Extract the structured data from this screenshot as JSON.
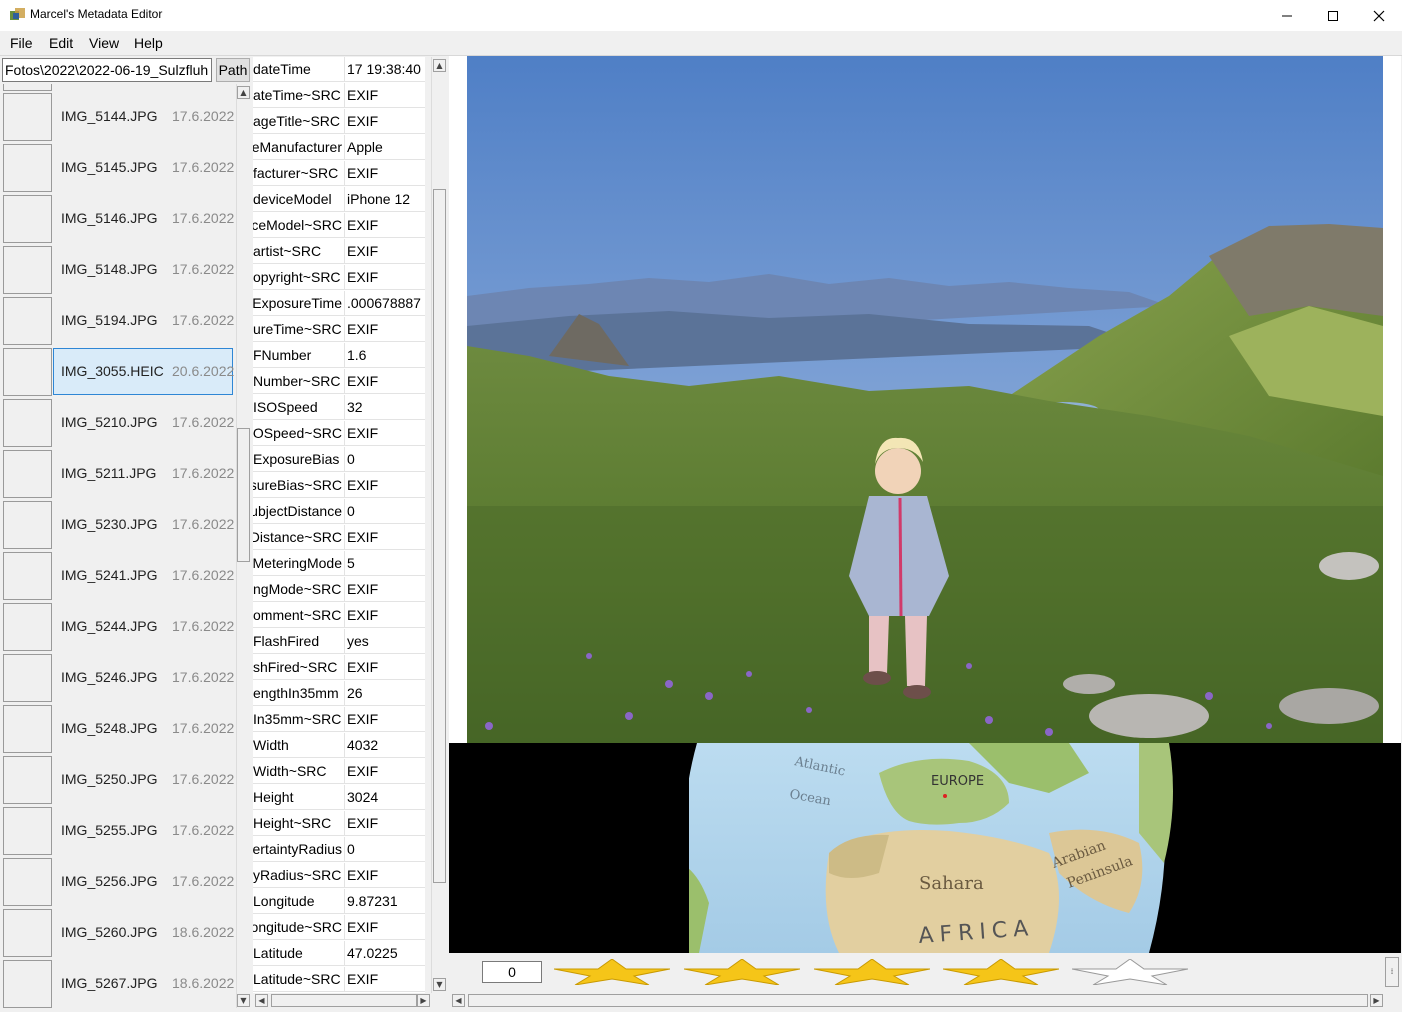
{
  "window": {
    "title": "Marcel's Metadata Editor",
    "minimize": "—",
    "maximize": "☐",
    "close": "✕"
  },
  "menu": [
    "File",
    "Edit",
    "View",
    "Help"
  ],
  "path": {
    "value": "Fotos\\2022\\2022-06-19_Sulzfluh",
    "button": "Path"
  },
  "files": [
    {
      "name": "IMG_5144.JPG",
      "date": "17.6.2022"
    },
    {
      "name": "IMG_5145.JPG",
      "date": "17.6.2022"
    },
    {
      "name": "IMG_5146.JPG",
      "date": "17.6.2022"
    },
    {
      "name": "IMG_5148.JPG",
      "date": "17.6.2022"
    },
    {
      "name": "IMG_5194.JPG",
      "date": "17.6.2022"
    },
    {
      "name": "IMG_3055.HEIC",
      "date": "20.6.2022"
    },
    {
      "name": "IMG_5210.JPG",
      "date": "17.6.2022"
    },
    {
      "name": "IMG_5211.JPG",
      "date": "17.6.2022"
    },
    {
      "name": "IMG_5230.JPG",
      "date": "17.6.2022"
    },
    {
      "name": "IMG_5241.JPG",
      "date": "17.6.2022"
    },
    {
      "name": "IMG_5244.JPG",
      "date": "17.6.2022"
    },
    {
      "name": "IMG_5246.JPG",
      "date": "17.6.2022"
    },
    {
      "name": "IMG_5248.JPG",
      "date": "17.6.2022"
    },
    {
      "name": "IMG_5250.JPG",
      "date": "17.6.2022"
    },
    {
      "name": "IMG_5255.JPG",
      "date": "17.6.2022"
    },
    {
      "name": "IMG_5256.JPG",
      "date": "17.6.2022"
    },
    {
      "name": "IMG_5260.JPG",
      "date": "18.6.2022"
    },
    {
      "name": "IMG_5267.JPG",
      "date": "18.6.2022"
    }
  ],
  "metadata": [
    {
      "key": "dateTime",
      "value": "17 19:38:40"
    },
    {
      "key": "ateTime~SRC",
      "value": "EXIF"
    },
    {
      "key": "ageTitle~SRC",
      "value": "EXIF"
    },
    {
      "key": "eManufacturer",
      "value": "Apple"
    },
    {
      "key": "facturer~SRC",
      "value": "EXIF"
    },
    {
      "key": "deviceModel",
      "value": "iPhone 12"
    },
    {
      "key": "ceModel~SRC",
      "value": "EXIF"
    },
    {
      "key": "artist~SRC",
      "value": "EXIF"
    },
    {
      "key": "opyright~SRC",
      "value": "EXIF"
    },
    {
      "key": "ExposureTime",
      "value": ".000678887"
    },
    {
      "key": "ureTime~SRC",
      "value": "EXIF"
    },
    {
      "key": "FNumber",
      "value": "1.6"
    },
    {
      "key": "Number~SRC",
      "value": "EXIF"
    },
    {
      "key": "ISOSpeed",
      "value": "32"
    },
    {
      "key": "OSpeed~SRC",
      "value": "EXIF"
    },
    {
      "key": "ExposureBias",
      "value": "0"
    },
    {
      "key": "sureBias~SRC",
      "value": "EXIF"
    },
    {
      "key": "ubjectDistance",
      "value": "0"
    },
    {
      "key": "Distance~SRC",
      "value": "EXIF"
    },
    {
      "key": "MeteringMode",
      "value": "5"
    },
    {
      "key": "ngMode~SRC",
      "value": "EXIF"
    },
    {
      "key": "omment~SRC",
      "value": "EXIF"
    },
    {
      "key": "FlashFired",
      "value": "yes"
    },
    {
      "key": "shFired~SRC",
      "value": "EXIF"
    },
    {
      "key": "engthIn35mm",
      "value": "26"
    },
    {
      "key": "In35mm~SRC",
      "value": "EXIF"
    },
    {
      "key": "Width",
      "value": "4032"
    },
    {
      "key": "Width~SRC",
      "value": "EXIF"
    },
    {
      "key": "Height",
      "value": "3024"
    },
    {
      "key": "Height~SRC",
      "value": "EXIF"
    },
    {
      "key": "ertaintyRadius",
      "value": "0"
    },
    {
      "key": "yRadius~SRC",
      "value": "EXIF"
    },
    {
      "key": "Longitude",
      "value": "9.87231"
    },
    {
      "key": "ongitude~SRC",
      "value": "EXIF"
    },
    {
      "key": "Latitude",
      "value": "47.0225"
    },
    {
      "key": "Latitude~SRC",
      "value": "EXIF"
    }
  ],
  "map": {
    "labels": [
      "Atlantic",
      "Ocean",
      "EUROPE",
      "Sahara",
      "Arabian",
      "Peninsula",
      "AFRICA"
    ]
  },
  "rating": {
    "value": "0",
    "stars_filled": 4,
    "stars_total": 5
  },
  "colors": {
    "selection_bg": "#d9ebf9",
    "selection_border": "#2e86d5",
    "star_fill": "#f5c518"
  }
}
